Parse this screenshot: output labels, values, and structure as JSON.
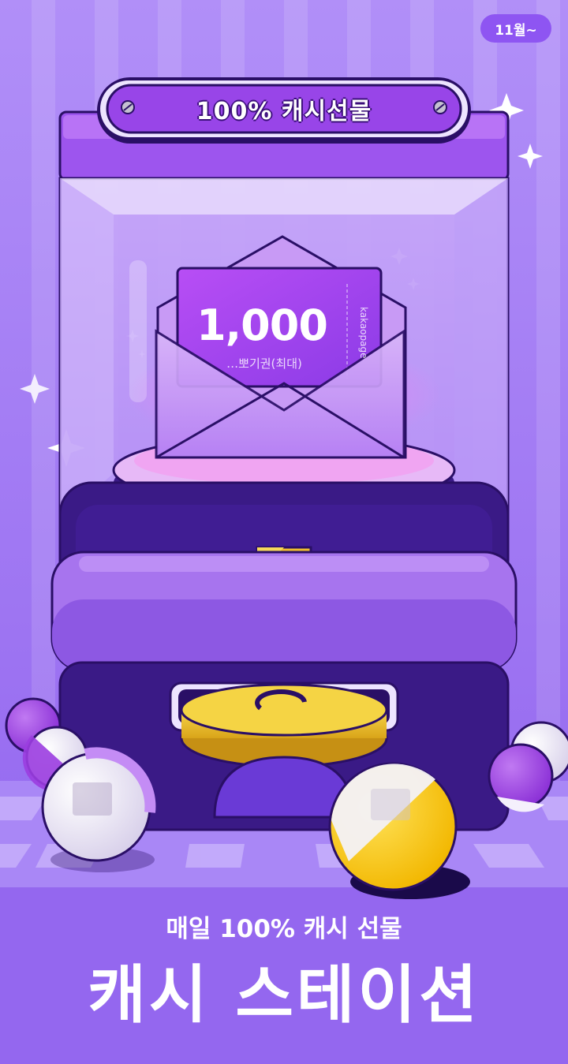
{
  "badge": {
    "month": "11월~"
  },
  "sign": {
    "text": "100% 캐시선물"
  },
  "ticket": {
    "amount": "1,000",
    "subtitle": "…뽀기권(최대)",
    "brand": "kakaopage"
  },
  "banner": {
    "subtitle": "매일 100% 캐시 선물",
    "title": "캐시 스테이션"
  },
  "colors": {
    "background": "#a37cf4",
    "machine_dark": "#3a1a86",
    "machine_light": "#a774ee",
    "accent_purple": "#b85cf5",
    "gold": "#f2c12e"
  }
}
